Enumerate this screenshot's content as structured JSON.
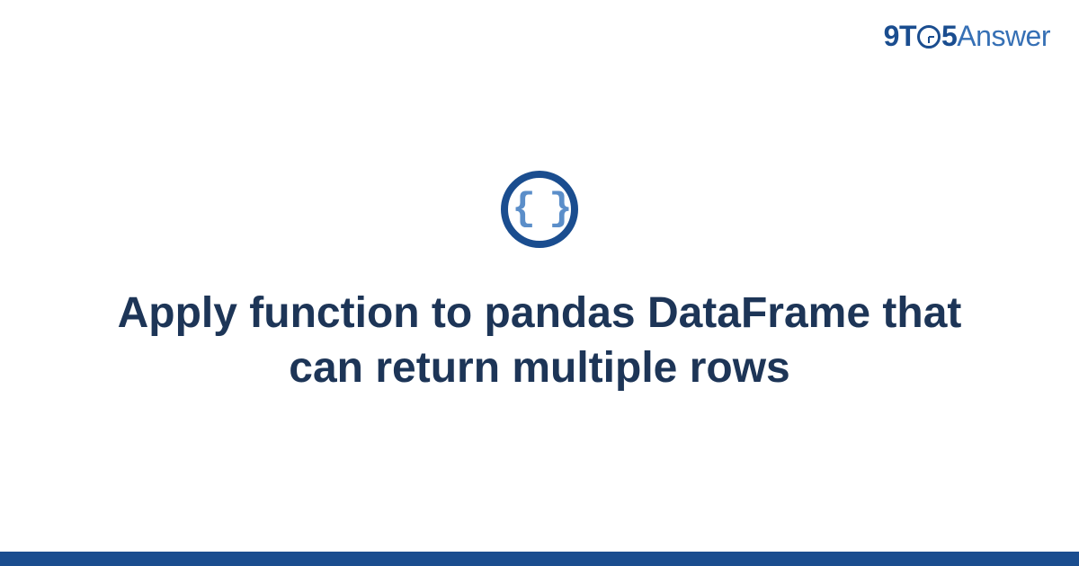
{
  "brand": {
    "prefix": "9T",
    "middle": "5",
    "suffix": "Answer"
  },
  "icon": {
    "name": "curly-braces-icon",
    "glyph": "{ }"
  },
  "title": "Apply function to pandas DataFrame that can return multiple rows",
  "colors": {
    "accent": "#1a4d8f",
    "title": "#1d3557",
    "iconInner": "#5b8ec9"
  }
}
